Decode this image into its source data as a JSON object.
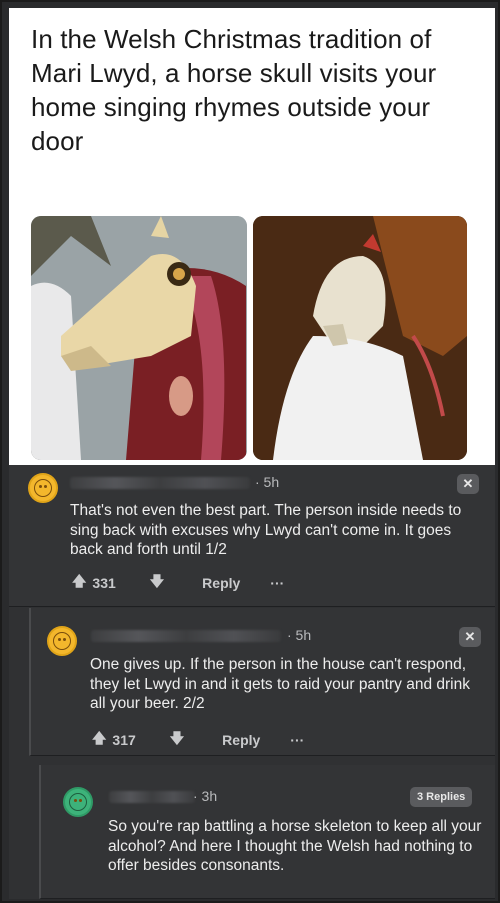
{
  "post": {
    "title": "In the Welsh Christmas tradition of Mari Lwyd, a horse skull visits your home singing rhymes outside your door"
  },
  "comments": [
    {
      "avatar_icon": "smiley-face-icon",
      "avatar_color": "#f3b72c",
      "time": "· 5h",
      "close_label": "✕",
      "text": "That's not even the best part. The person inside needs to sing back with excuses why Lwyd can't come in. It goes back and forth until 1/2",
      "score": "331",
      "reply_label": "Reply",
      "more_label": "···"
    },
    {
      "avatar_icon": "smiley-face-icon",
      "avatar_color": "#f3b72c",
      "time": "· 5h",
      "close_label": "✕",
      "text": "One gives up. If the person in the house can't respond, they let Lwyd in and it gets to raid your pantry and drink all your beer. 2/2",
      "score": "317",
      "reply_label": "Reply",
      "more_label": "···"
    },
    {
      "avatar_icon": "cow-face-icon",
      "avatar_color": "#3db27a",
      "time": "· 3h",
      "replies_label": "3 Replies",
      "text": "So you're rap battling a horse skeleton to keep all your alcohol? And here I thought the Welsh had nothing to offer besides consonants."
    }
  ]
}
